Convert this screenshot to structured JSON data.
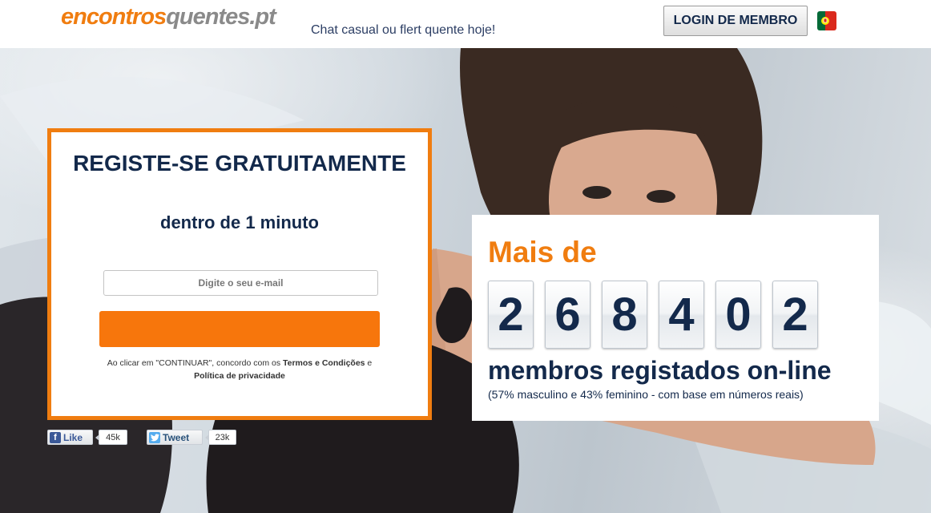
{
  "header": {
    "logo_part1": "encontros",
    "logo_part2": "quentes.pt",
    "tagline": "Chat casual ou flert quente hoje!",
    "login_label": "LOGIN DE MEMBRO",
    "flag_icon": "portugal-flag-icon"
  },
  "register": {
    "title": "REGISTE-SE GRATUITAMENTE",
    "subtitle": "dentro de 1 minuto",
    "email_placeholder": "Digite o seu e-mail",
    "continue_label": "",
    "terms_prefix": "Ao clicar em \"CONTINUAR\", concordo com os ",
    "terms_link": "Termos e Condições",
    "terms_and": " e ",
    "privacy_link": "Política de privacidade"
  },
  "social": {
    "like_label": "Like",
    "like_count": "45k",
    "tweet_label": "Tweet",
    "tweet_count": "23k"
  },
  "counter": {
    "prefix": "Mais de",
    "digits": [
      "2",
      "6",
      "8",
      "4",
      "0",
      "2"
    ],
    "label": "membros registados on-line",
    "note": "(57% masculino e 43% feminino - com base em números reais)"
  },
  "colors": {
    "accent_orange": "#f07d10",
    "button_orange": "#f7760c",
    "navy": "#13294b"
  }
}
